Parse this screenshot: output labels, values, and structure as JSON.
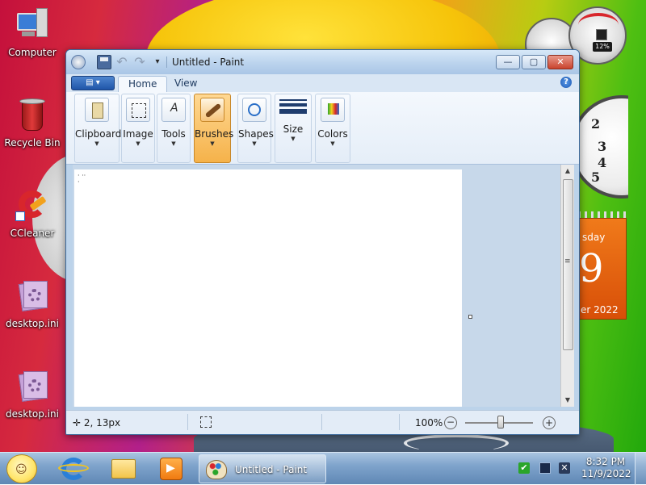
{
  "desktop": {
    "icons": [
      {
        "label": "Computer"
      },
      {
        "label": "Recycle Bin"
      },
      {
        "label": "CCleaner"
      },
      {
        "label": "desktop.ini"
      },
      {
        "label": "desktop.ini"
      }
    ]
  },
  "gadgets": {
    "meter": {
      "cpu_label": "12%"
    },
    "clock": {
      "numbers": [
        "2",
        "3",
        "4",
        "5"
      ]
    },
    "calendar": {
      "day_partial": "sday",
      "date_partial": "9",
      "month_partial": "er 2022"
    }
  },
  "paint": {
    "title": "Untitled - Paint",
    "tabs": {
      "home": "Home",
      "view": "View"
    },
    "file_menu_icon": "paint-menu-icon",
    "help": "?",
    "groups": {
      "clipboard": "Clipboard",
      "image": "Image",
      "tools": "Tools",
      "brushes": "Brushes",
      "shapes": "Shapes",
      "size": "Size",
      "colors": "Colors"
    },
    "status": {
      "cursor_position": "2, 13px",
      "zoom": "100%",
      "zoom_level_percent": 100
    },
    "window_buttons": {
      "minimize": "—",
      "maximize": "▢",
      "close": "✕"
    }
  },
  "taskbar": {
    "active_task": "Untitled - Paint",
    "time": "8:32 PM",
    "date": "11/9/2022"
  },
  "colors": {
    "accent_brushes_selected": "#f5b24a",
    "titlebar": "#bdd5ee",
    "taskbar": "#7fa4cc"
  }
}
